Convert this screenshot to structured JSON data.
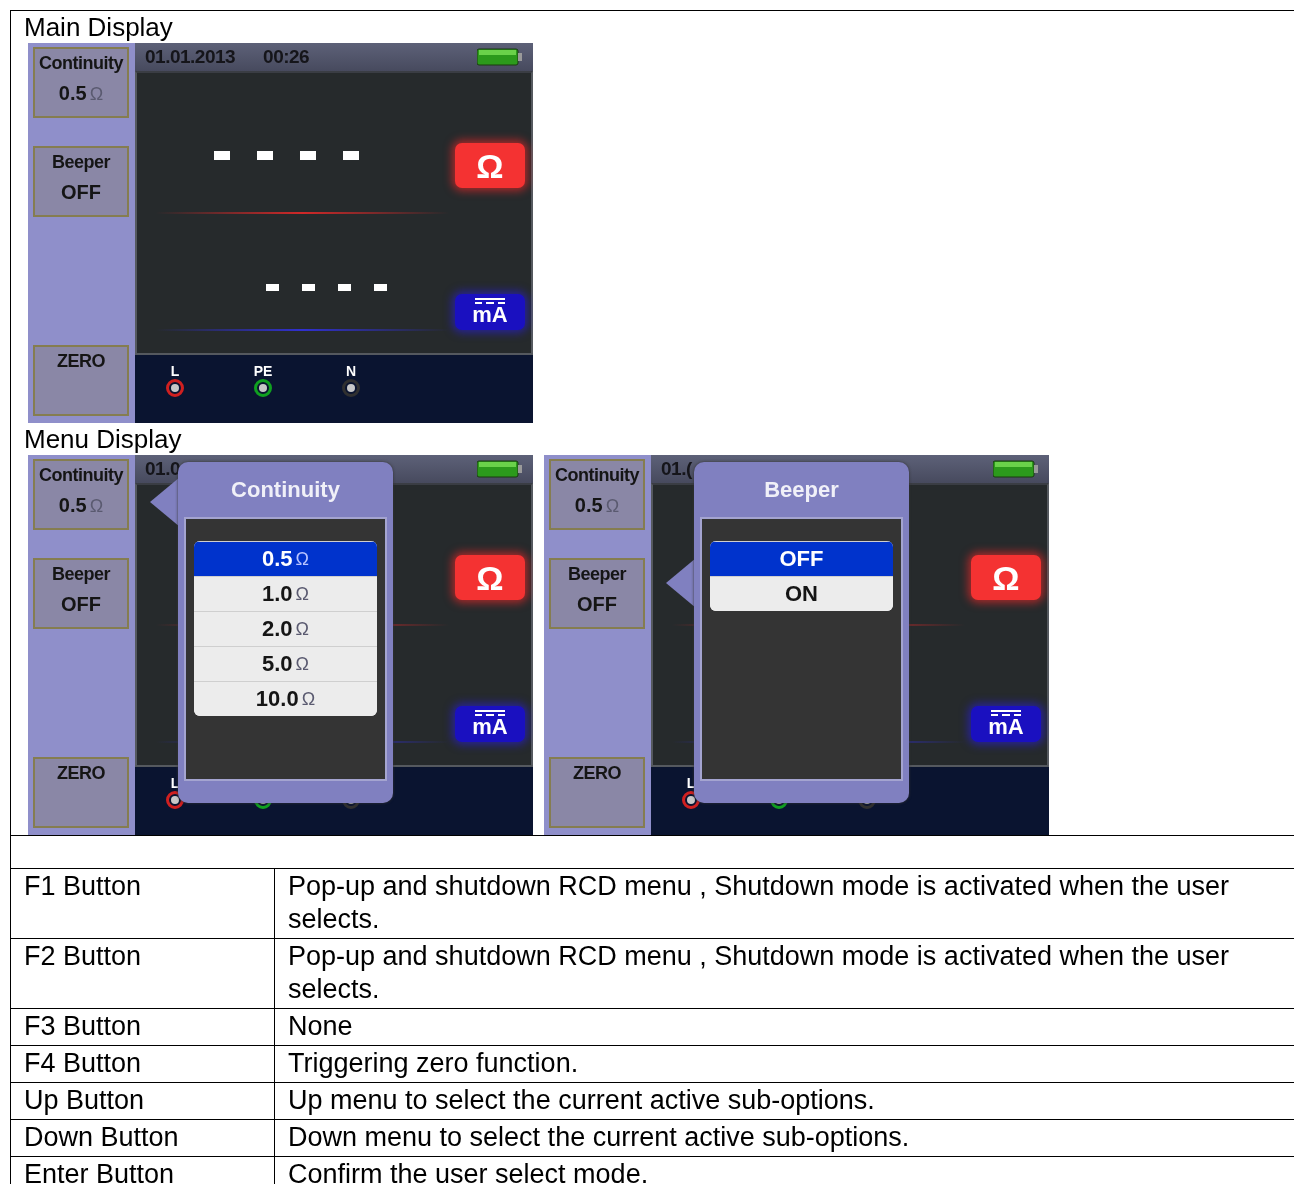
{
  "sections": [
    {
      "title": "Main Display",
      "screens": [
        {
          "date": "01.01.2013",
          "time": "00:26",
          "sidebar": [
            {
              "label": "Continuity",
              "value": "0.5",
              "unit": "Ω"
            },
            {
              "label": "Beeper",
              "value": "OFF"
            },
            {
              "label": "ZERO"
            }
          ],
          "readings": [
            {
              "kind": "resistance",
              "badge": "Ω"
            },
            {
              "kind": "current",
              "badge": "mA"
            }
          ],
          "terminals": [
            {
              "label": "L",
              "color": "#d02020"
            },
            {
              "label": "PE",
              "color": "#10a020"
            },
            {
              "label": "N",
              "color": "#303030"
            }
          ]
        }
      ]
    },
    {
      "title": "Menu Display",
      "screens": [
        {
          "date": "01.0",
          "sidebar": [
            {
              "label": "Continuity",
              "value": "0.5",
              "unit": "Ω"
            },
            {
              "label": "Beeper",
              "value": "OFF"
            },
            {
              "label": "ZERO"
            }
          ],
          "readings": [
            {
              "kind": "resistance",
              "badge": "Ω"
            },
            {
              "kind": "current",
              "badge": "mA"
            }
          ],
          "terminals": [
            {
              "label": "L",
              "color": "#d02020"
            },
            {
              "color": "#10a020"
            },
            {
              "color": "#303030"
            }
          ],
          "popup": {
            "kind": "continuity",
            "title": "Continuity",
            "options": [
              {
                "value": "0.5",
                "unit": "Ω",
                "selected": true
              },
              {
                "value": "1.0",
                "unit": "Ω",
                "selected": false
              },
              {
                "value": "2.0",
                "unit": "Ω",
                "selected": false
              },
              {
                "value": "5.0",
                "unit": "Ω",
                "selected": false
              },
              {
                "value": "10.0",
                "unit": "Ω",
                "selected": false
              }
            ]
          }
        },
        {
          "date": "01.(",
          "sidebar": [
            {
              "label": "Continuity",
              "value": "0.5",
              "unit": "Ω"
            },
            {
              "label": "Beeper",
              "value": "OFF"
            },
            {
              "label": "ZERO"
            }
          ],
          "readings": [
            {
              "kind": "resistance",
              "badge": "Ω"
            },
            {
              "kind": "current",
              "badge": "mA"
            }
          ],
          "terminals": [
            {
              "label": "L",
              "color": "#d02020"
            },
            {
              "color": "#10a020"
            },
            {
              "color": "#303030"
            }
          ],
          "popup": {
            "kind": "beeper",
            "title": "Beeper",
            "options": [
              {
                "value": "OFF",
                "selected": true
              },
              {
                "value": "ON",
                "selected": false
              }
            ]
          }
        }
      ]
    }
  ],
  "button_table": {
    "rows": [
      {
        "button": "F1 Button",
        "description": "Pop-up and shutdown RCD menu , Shutdown mode is activated when the user selects."
      },
      {
        "button": "F2 Button",
        "description": "Pop-up and shutdown RCD menu , Shutdown mode is activated when the user selects."
      },
      {
        "button": "F3 Button",
        "description": "None"
      },
      {
        "button": "F4 Button",
        "description": "Triggering zero function."
      },
      {
        "button": "Up Button",
        "description": "Up menu to select the current active sub-options."
      },
      {
        "button": "Down Button",
        "description": "Down menu to select the current active sub-options."
      },
      {
        "button": "Enter Button",
        "description": "Confirm the user select mode."
      }
    ]
  }
}
